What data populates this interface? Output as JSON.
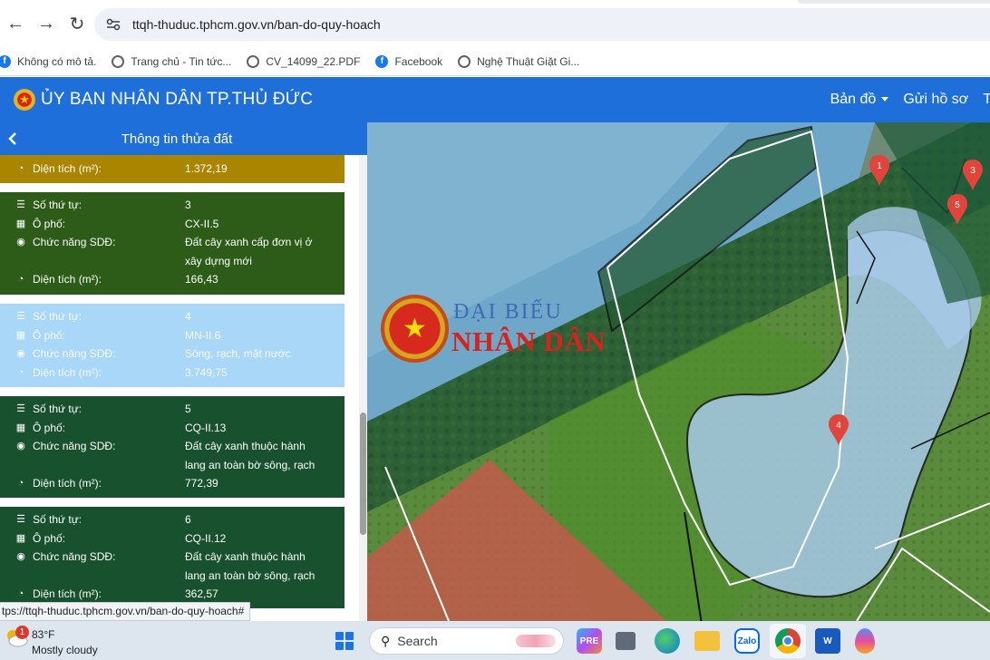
{
  "browser": {
    "url": "ttqh-thuduc.tphcm.gov.vn/ban-do-quy-hoach",
    "status_url": "tps://ttqh-thuduc.tphcm.gov.vn/ban-do-quy-hoach#",
    "bookmarks": [
      {
        "label": "Không có mô tả.",
        "icon": "facebook-icon"
      },
      {
        "label": "Trang chủ - Tin tức...",
        "icon": "globe-icon"
      },
      {
        "label": "CV_14099_22.PDF",
        "icon": "globe-icon"
      },
      {
        "label": "Facebook",
        "icon": "facebook-icon"
      },
      {
        "label": "Nghệ Thuật Giặt Gi...",
        "icon": "globe-icon"
      }
    ]
  },
  "header": {
    "title": "ỦY BAN NHÂN DÂN TP.THỦ ĐỨC",
    "menu": [
      "Bản đồ",
      "Gửi hồ sơ",
      "T"
    ]
  },
  "panel": {
    "title": "Thông tin thửa đất",
    "labels": {
      "so_thu_tu": "Số thứ tự:",
      "o_pho": "Ô phố:",
      "chuc_nang": "Chức năng SDĐ:",
      "dien_tich": "Diện tích (m²):"
    },
    "top_partial": {
      "dien_tich": "1.372,19"
    },
    "cards": [
      {
        "so_thu_tu": "3",
        "o_pho": "CX-II.5",
        "chuc_nang_1": "Đất cây xanh cấp đơn vị ở",
        "chuc_nang_2": "xây dựng mới",
        "dien_tich": "166,43"
      },
      {
        "so_thu_tu": "4",
        "o_pho": "MN-II.6",
        "chuc_nang_1": "Sông, rạch, mặt nước",
        "dien_tich": "3.749,75"
      },
      {
        "so_thu_tu": "5",
        "o_pho": "CQ-II.13",
        "chuc_nang_1": "Đất cây xanh thuộc hành",
        "chuc_nang_2": "lang an toàn bờ sông, rạch",
        "dien_tich": "772,39"
      },
      {
        "so_thu_tu": "6",
        "o_pho": "CQ-II.12",
        "chuc_nang_1": "Đất cây xanh thuộc hành",
        "chuc_nang_2": "lang an toàn bờ sông, rạch",
        "dien_tich": "362,57"
      }
    ]
  },
  "map": {
    "markers": [
      "1",
      "3",
      "5",
      "4"
    ],
    "watermark_line1": "ĐẠI BIỂU",
    "watermark_line2": "NHÂN DÂN"
  },
  "taskbar": {
    "weather_badge": "1",
    "temperature": "83°F",
    "condition": "Mostly cloudy",
    "search_placeholder": "Search",
    "zalo_label": "Zalo"
  },
  "colors": {
    "header_blue": "#1e6fd9",
    "card_dark_green": "#2c5c17",
    "card_teal": "#17512d",
    "card_light_blue": "#a9d7f7",
    "card_gold": "#a98500",
    "marker_red": "#e0443a"
  }
}
